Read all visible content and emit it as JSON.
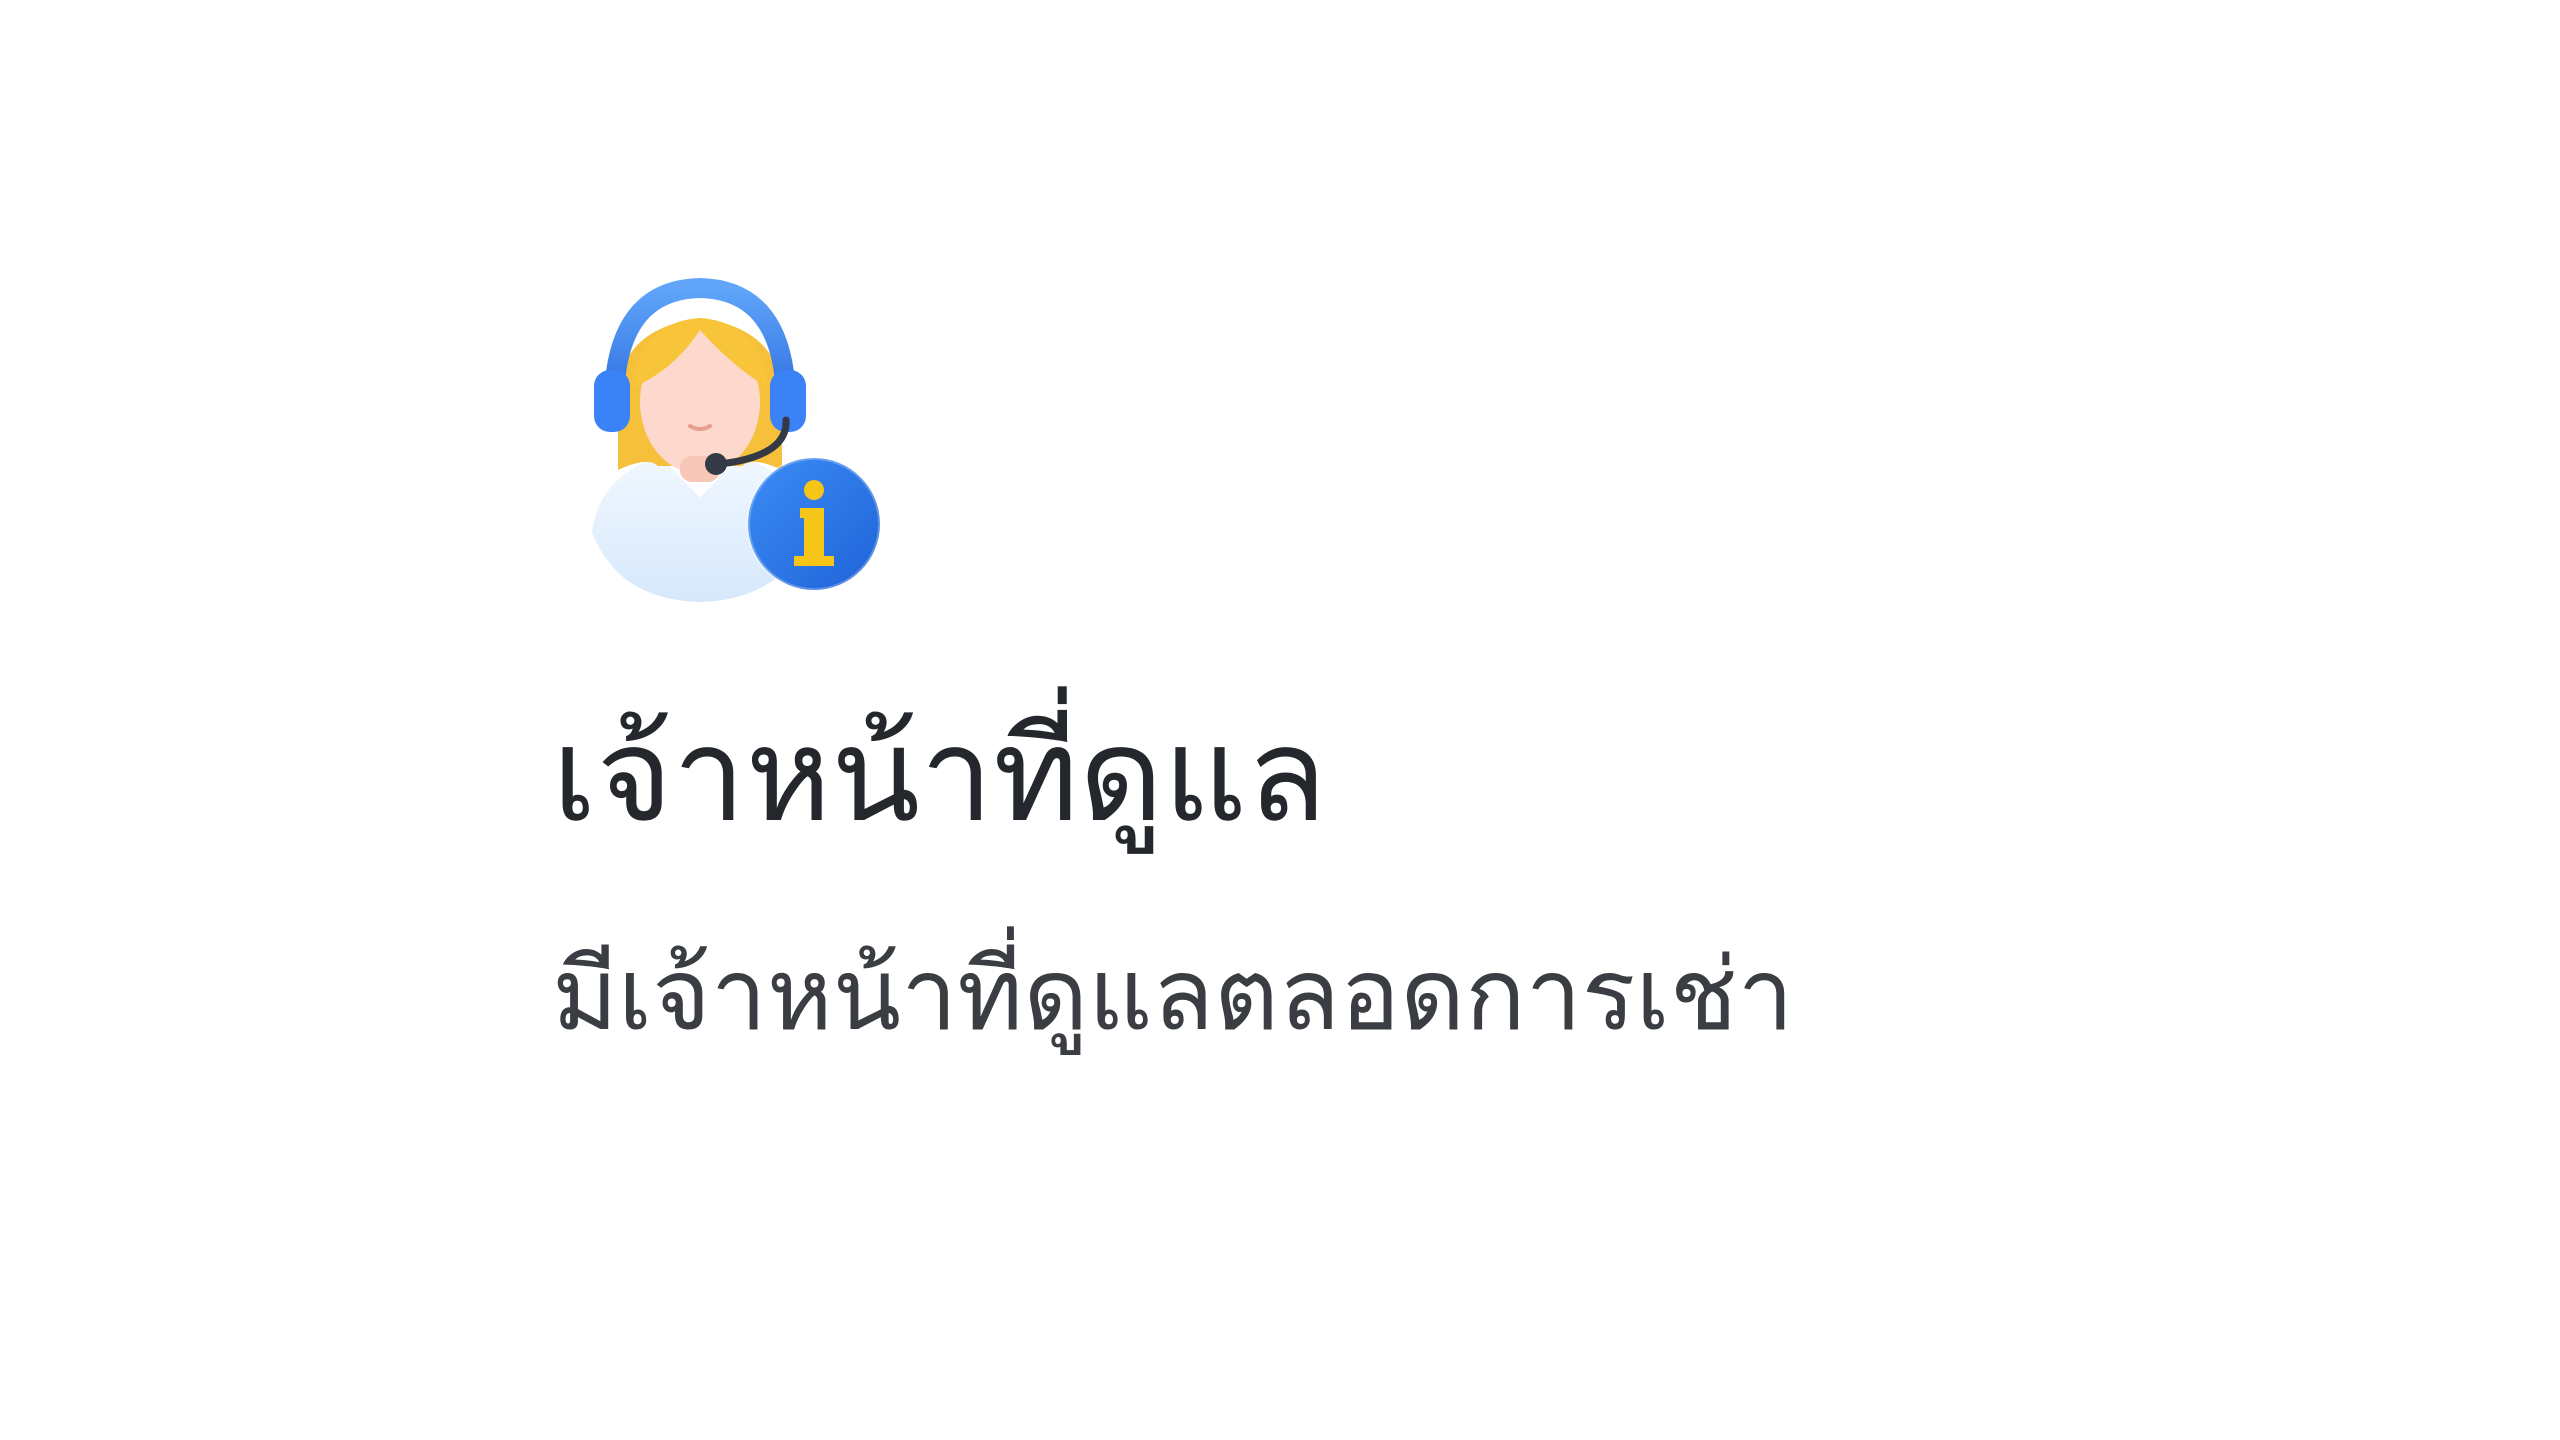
{
  "feature": {
    "icon": "support-agent-info-icon",
    "title": "เจ้าหน้าที่ดูแล",
    "description": "มีเจ้าหน้าที่ดูแลตลอดการเช่า"
  },
  "colors": {
    "background": "#ffffff",
    "title_text": "#24272c",
    "description_text": "#3a3d42",
    "headset_blue": "#3b82f6",
    "info_badge_blue": "#2f7ff0",
    "info_glyph_yellow": "#f5c518",
    "hair_yellow": "#f8c53a",
    "skin": "#fcd9cc"
  }
}
